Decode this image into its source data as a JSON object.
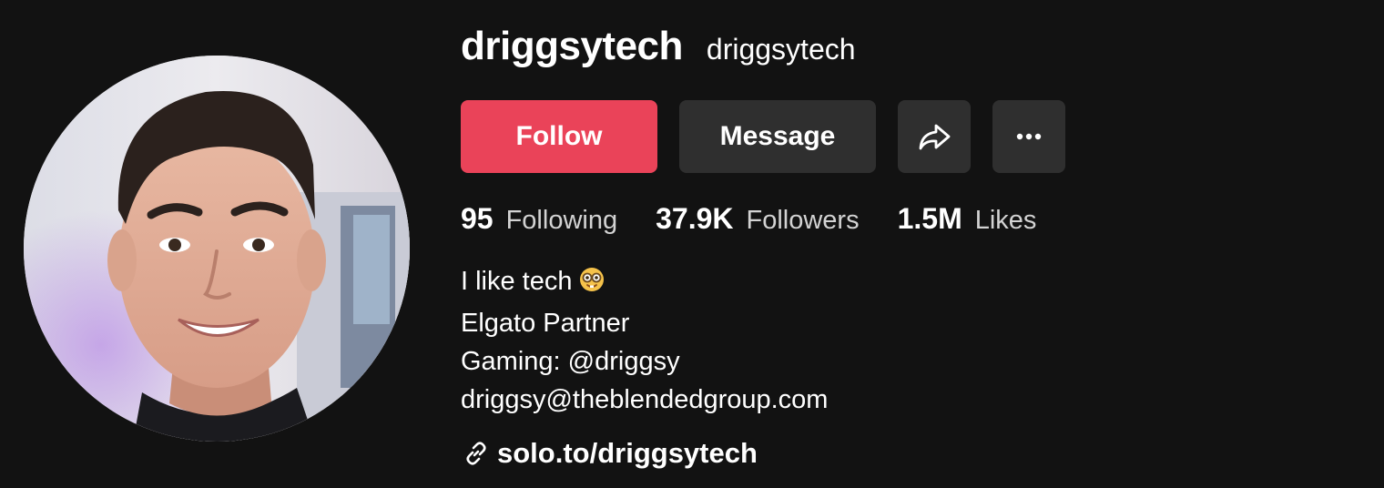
{
  "profile": {
    "display_name": "driggsytech",
    "username": "driggsytech"
  },
  "actions": {
    "follow_label": "Follow",
    "message_label": "Message",
    "share_icon": "share-arrow-icon",
    "more_icon": "more-horizontal-icon"
  },
  "stats": [
    {
      "value": "95",
      "label": "Following"
    },
    {
      "value": "37.9K",
      "label": "Followers"
    },
    {
      "value": "1.5M",
      "label": "Likes"
    }
  ],
  "bio": {
    "line1": "I like tech",
    "line1_emoji": "nerd-face-emoji",
    "line2": "Elgato Partner",
    "line3": "Gaming: @driggsy",
    "line4": "driggsy@theblendedgroup.com"
  },
  "link": {
    "icon": "link-icon",
    "text": "solo.to/driggsytech"
  },
  "colors": {
    "background": "#121212",
    "follow_button": "#ea4359",
    "secondary_button": "#2f2f2f",
    "stat_label": "#d3d3d3"
  }
}
